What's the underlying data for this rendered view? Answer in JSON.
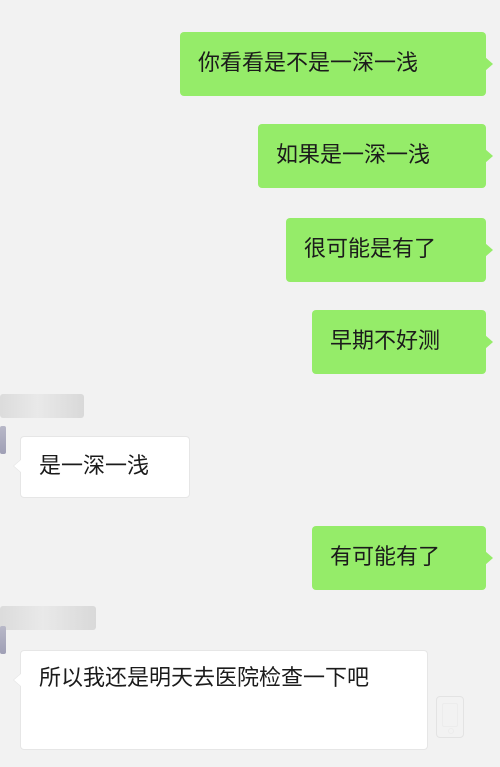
{
  "chat": {
    "messages": [
      {
        "sender": "self",
        "text": "你看看是不是一深一浅"
      },
      {
        "sender": "self",
        "text": "如果是一深一浅"
      },
      {
        "sender": "self",
        "text": "很可能是有了"
      },
      {
        "sender": "self",
        "text": "早期不好测"
      },
      {
        "sender": "other",
        "text": "是一深一浅"
      },
      {
        "sender": "self",
        "text": "有可能有了"
      },
      {
        "sender": "other",
        "text": "所以我还是明天去医院检查一下吧"
      }
    ]
  },
  "colors": {
    "background": "#f2f2f2",
    "self_bubble": "#95ec69",
    "other_bubble": "#ffffff",
    "text": "#1b1b1b"
  }
}
